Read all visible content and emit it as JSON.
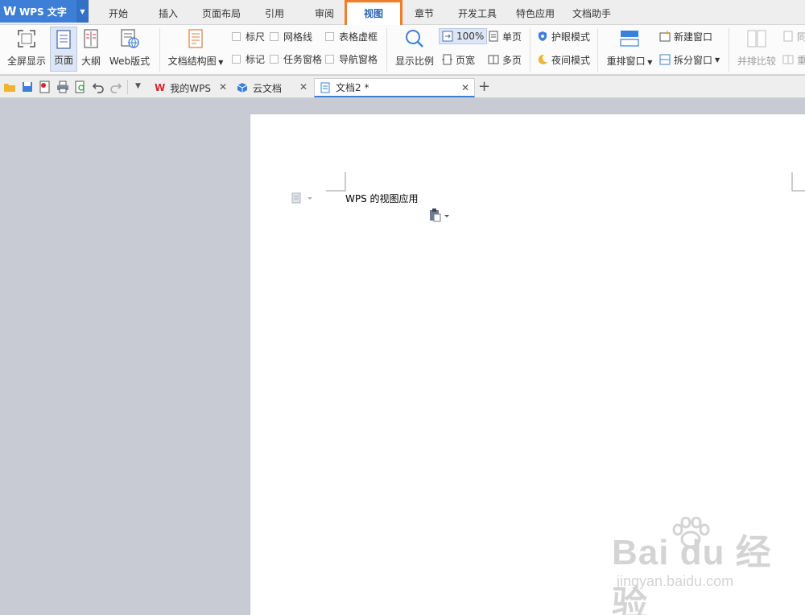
{
  "app": {
    "name": "WPS 文字"
  },
  "menu": {
    "tabs": [
      "开始",
      "插入",
      "页面布局",
      "引用",
      "审阅",
      "视图",
      "章节",
      "开发工具",
      "特色应用",
      "文档助手"
    ],
    "active": "视图"
  },
  "ribbon": {
    "fullscreen": "全屏显示",
    "page": "页面",
    "outline": "大纲",
    "web": "Web版式",
    "doc_structure": "文档结构图",
    "ruler": "标尺",
    "gridlines": "网格线",
    "table_grid": "表格虚框",
    "marks": "标记",
    "task_pane": "任务窗格",
    "nav_pane": "导航窗格",
    "zoom": "显示比例",
    "zoom_100": "100%",
    "single_page": "单页",
    "page_width": "页宽",
    "multi_page": "多页",
    "eye_mode": "护眼模式",
    "night_mode": "夜间模式",
    "rearrange": "重排窗口",
    "new_window": "新建窗口",
    "split_window": "拆分窗口",
    "side_by_side": "并排比较",
    "sync_scroll": "同",
    "reset": "重"
  },
  "doc_tabs": [
    {
      "label": "我的WPS"
    },
    {
      "label": "云文档"
    },
    {
      "label": "文档2 *"
    }
  ],
  "document": {
    "text": "WPS 的视图应用"
  },
  "watermark": {
    "brand": "Bai du 经验",
    "url": "jingyan.baidu.com"
  },
  "colors": {
    "accent": "#3d7fd6",
    "highlight": "#f07d2a",
    "wps_red": "#d9262c"
  }
}
